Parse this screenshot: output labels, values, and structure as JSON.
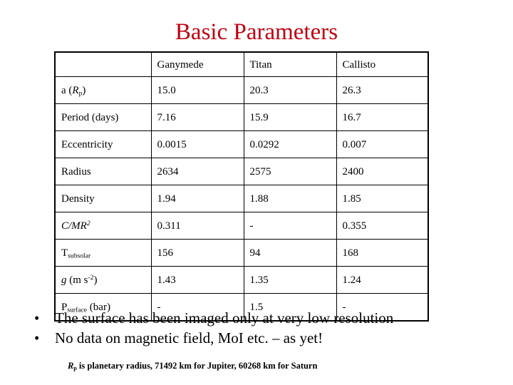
{
  "slide": {
    "title": "Basic Parameters",
    "title_color": "#C00011"
  },
  "table": {
    "columns": [
      "",
      "Ganymede",
      "Titan",
      "Callisto"
    ],
    "rows": [
      {
        "label_plain": "a (Rp)",
        "values": [
          "15.0",
          "20.3",
          "26.3"
        ]
      },
      {
        "label_plain": "Period (days)",
        "values": [
          "7.16",
          "15.9",
          "16.7"
        ]
      },
      {
        "label_plain": "Eccentricity",
        "values": [
          "0.0015",
          "0.0292",
          "0.007"
        ]
      },
      {
        "label_plain": "Radius",
        "values": [
          "2634",
          "2575",
          "2400"
        ]
      },
      {
        "label_plain": "Density",
        "values": [
          "1.94",
          "1.88",
          "1.85"
        ]
      },
      {
        "label_plain": "C/MR2",
        "values": [
          "0.311",
          "-",
          "0.355"
        ]
      },
      {
        "label_plain": "Tsubsolar",
        "values": [
          "156",
          "94",
          "168"
        ]
      },
      {
        "label_plain": "g (m s-2)",
        "values": [
          "1.43",
          "1.35",
          "1.24"
        ]
      },
      {
        "label_plain": "Psurface (bar)",
        "values": [
          "-",
          "1.5",
          "-"
        ]
      }
    ],
    "label_parts": {
      "row0": {
        "pre": "a (",
        "italic": "R",
        "sub": "p",
        "post": ")"
      },
      "row5": {
        "italic": "C/MR",
        "sup": "2"
      },
      "row6": {
        "pre": "T",
        "sub": "subsolar"
      },
      "row7": {
        "italic": "g",
        "pre2": " (m s",
        "sup": "-2",
        "post": ")"
      },
      "row8": {
        "pre": "P",
        "sub": "surface",
        "post": " (bar)"
      }
    }
  },
  "bullets": [
    {
      "marker": "bullet-dot",
      "text": "The surface has been imaged only at very low resolution"
    },
    {
      "marker": "bullet-dot",
      "text": "No data on magnetic field, MoI etc. – as yet!"
    }
  ],
  "footnote": {
    "italic": "R",
    "sub": "p",
    "text": " is planetary radius, 71492 km for Jupiter, 60268 km for Saturn"
  }
}
